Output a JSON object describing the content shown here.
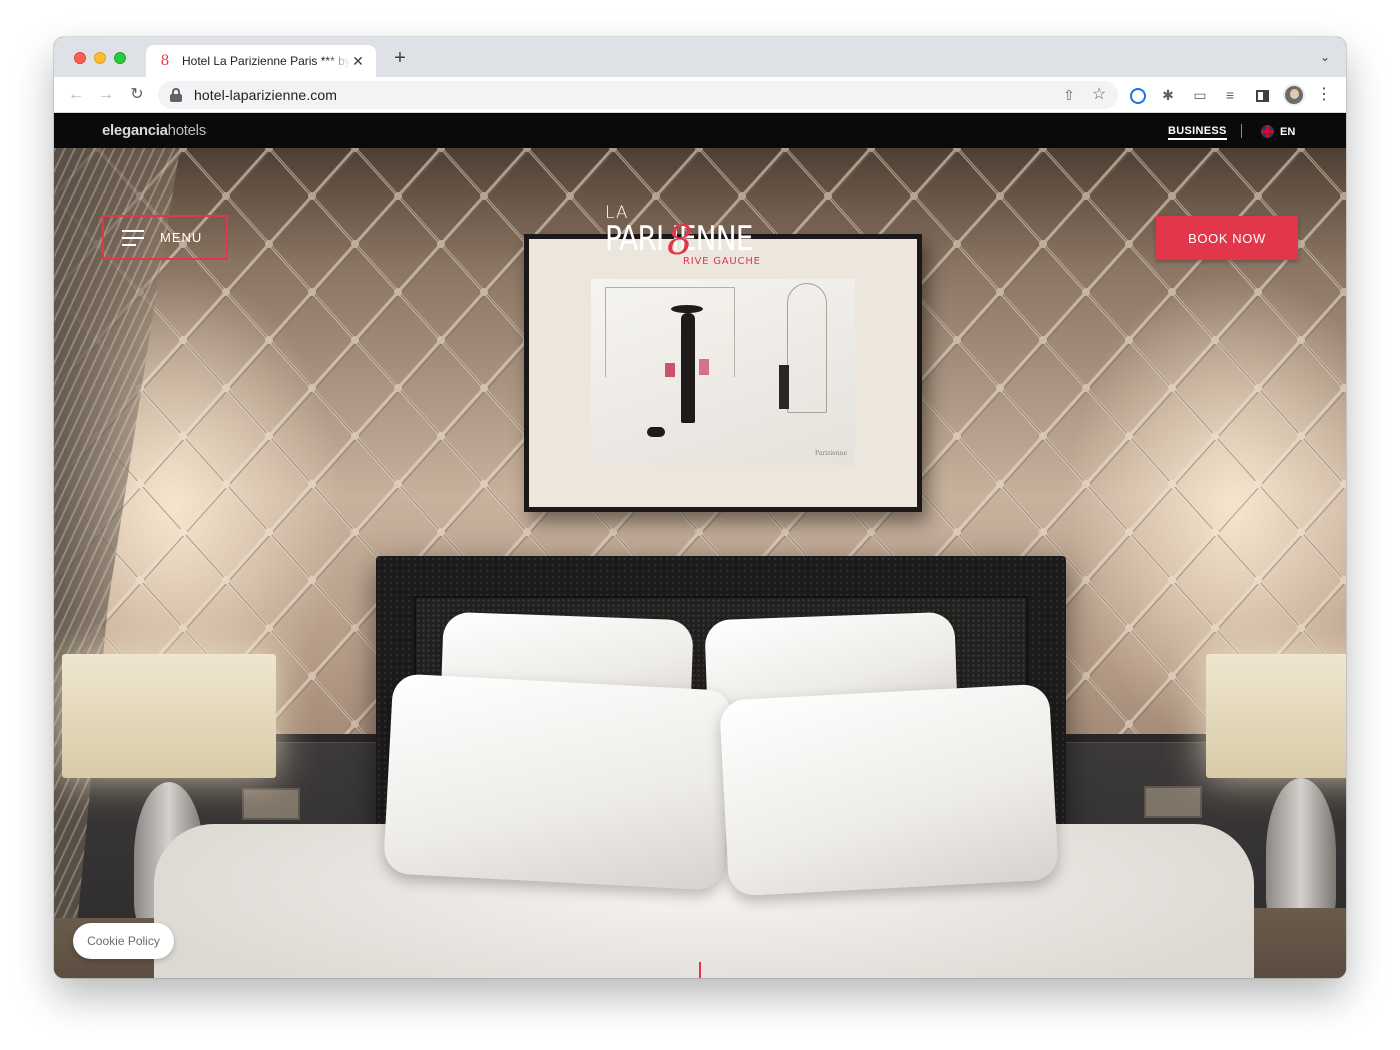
{
  "browser": {
    "tab_title": "Hotel La Parizienne Paris *** by Elegancia",
    "url": "hotel-laparizienne.com",
    "close_glyph": "✕",
    "new_tab_glyph": "+",
    "dropdown_glyph": "⌄",
    "favicon_glyph": "8"
  },
  "site": {
    "brand_bold": "elegancia",
    "brand_light": "hotels",
    "business_label": "BUSINESS",
    "language_label": "EN",
    "menu_label": "MENU",
    "logo_la": "LA",
    "logo_main": "PARI IENNE",
    "logo_z": "8",
    "logo_sub": "RIVE GAUCHE",
    "book_label": "BOOK NOW",
    "cookie_label": "Cookie Policy",
    "art_signature": "Parizienne"
  },
  "colors": {
    "accent": "#e2374a",
    "topbar": "#0a0a0a"
  },
  "icons": {
    "back": "arrow-left-icon",
    "forward": "arrow-right-icon",
    "reload": "reload-icon",
    "lock": "lock-icon",
    "share": "share-icon",
    "star": "star-icon",
    "extensions": "puzzle-icon",
    "cast": "cast-icon",
    "media": "media-control-icon",
    "sidepanel": "side-panel-icon",
    "menu": "hamburger-icon",
    "flag": "uk-flag-icon"
  }
}
